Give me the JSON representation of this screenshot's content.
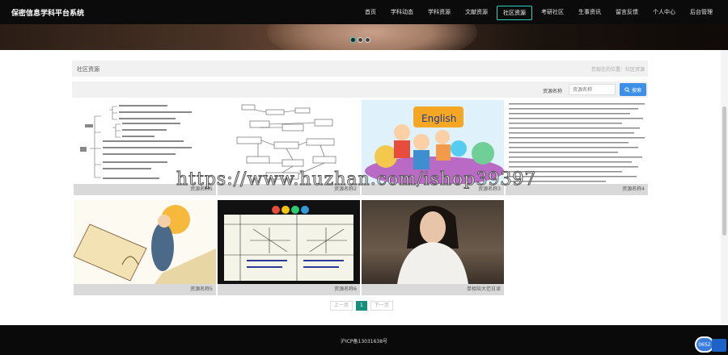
{
  "app": {
    "title": "保密信息学科平台系统"
  },
  "nav": {
    "items": [
      {
        "label": "首页",
        "active": false
      },
      {
        "label": "学科动态",
        "active": false
      },
      {
        "label": "学科资源",
        "active": false
      },
      {
        "label": "文献资源",
        "active": false
      },
      {
        "label": "社区资源",
        "active": true
      },
      {
        "label": "考研社区",
        "active": false
      },
      {
        "label": "生事资讯",
        "active": false
      },
      {
        "label": "留言反馈",
        "active": false
      },
      {
        "label": "个人中心",
        "active": false
      },
      {
        "label": "后台管理",
        "active": false
      }
    ]
  },
  "carousel": {
    "slides": 3,
    "active_index": 0
  },
  "section": {
    "title": "社区资源",
    "breadcrumb": "您现在的位置：社区资源"
  },
  "search": {
    "label": "资源名称",
    "placeholder": "资源名称",
    "button": "搜索"
  },
  "cards": [
    {
      "caption": "资源名称1",
      "thumb": "mindmap-text"
    },
    {
      "caption": "资源名称2",
      "thumb": "flowchart"
    },
    {
      "caption": "资源名称3",
      "thumb": "english-kids"
    },
    {
      "caption": "资源名称4",
      "thumb": "dense-table"
    },
    {
      "caption": "资源名称5",
      "thumb": "scholar-illustration"
    },
    {
      "caption": "资源名称6",
      "thumb": "math-graphs"
    },
    {
      "caption": "单相培大范日读",
      "thumb": "portrait-woman"
    }
  ],
  "pager": {
    "prev": "上一页",
    "current": "1",
    "next": "下一页"
  },
  "footer": {
    "icp": "沪ICP备13031638号"
  },
  "badge": {
    "text": "0652"
  },
  "watermark": "https://www.huzhan.com/ishop39397",
  "colors": {
    "accent": "#2bd2c4",
    "search_button": "#3d8fe8",
    "pager_active": "#1a8f7c",
    "nav_bg": "#0b0b0b"
  }
}
